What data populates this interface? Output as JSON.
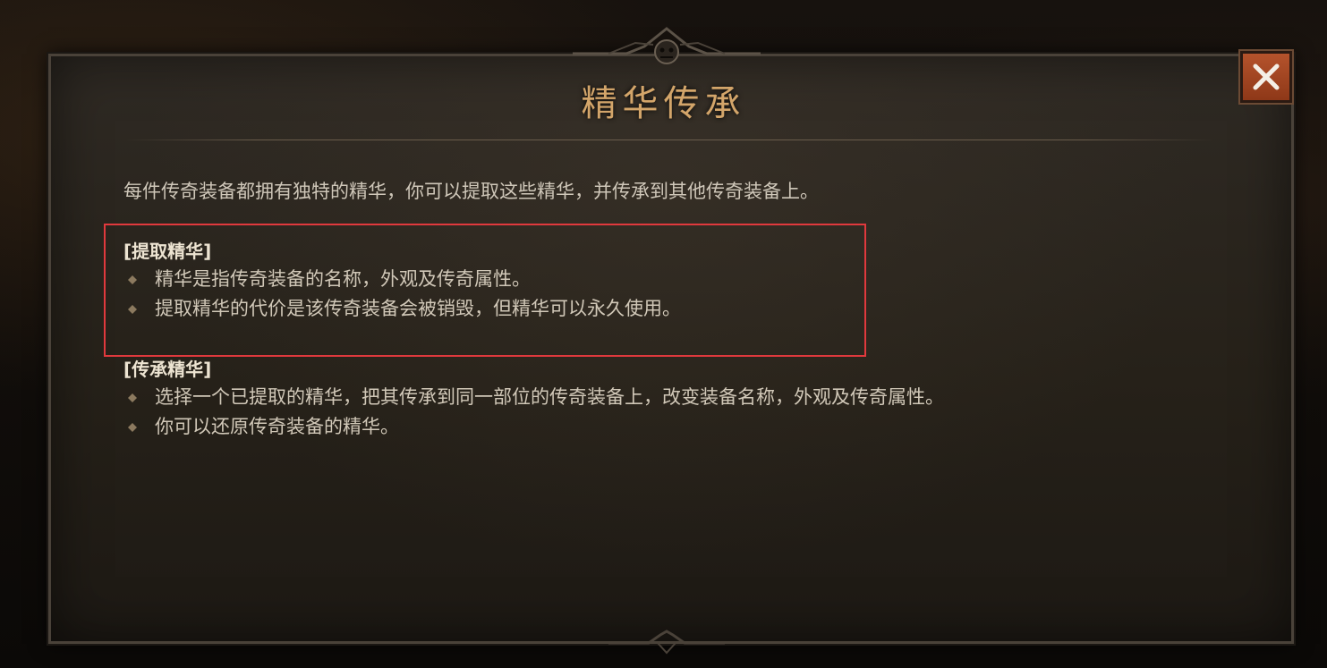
{
  "dialog": {
    "title": "精华传承",
    "close_icon": "close-icon",
    "intro": "每件传奇装备都拥有独特的精华，你可以提取这些精华，并传承到其他传奇装备上。",
    "sections": [
      {
        "heading": "[提取精华]",
        "bullets": [
          "精华是指传奇装备的名称，外观及传奇属性。",
          "提取精华的代价是该传奇装备会被销毁，但精华可以永久使用。"
        ]
      },
      {
        "heading": "[传承精华]",
        "bullets": [
          "选择一个已提取的精华，把其传承到同一部位的传奇装备上，改变装备名称，外观及传奇属性。",
          "你可以还原传奇装备的精华。"
        ]
      }
    ]
  },
  "colors": {
    "title": "#d3a56a",
    "highlight_box": "#e0393d",
    "close_button": "#a9482a"
  }
}
